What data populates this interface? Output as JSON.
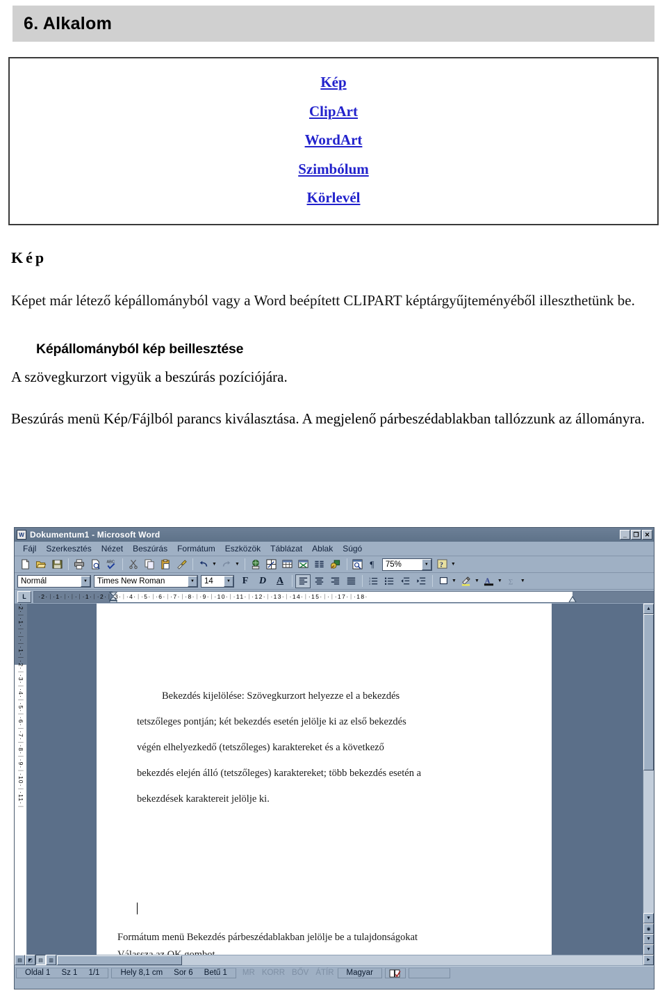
{
  "banner": {
    "title": "6. Alkalom"
  },
  "linkbox": {
    "links": [
      {
        "label": "Kép"
      },
      {
        "label": "ClipArt"
      },
      {
        "label": "WordArt"
      },
      {
        "label": "Szimbólum"
      },
      {
        "label": "Körlevél"
      }
    ]
  },
  "content": {
    "heading": "Kép",
    "intro": "Képet már létező képállományból vagy a Word beépített CLIPART képtárgyűjteményéből illeszthetünk be.",
    "subheading": "Képállományból kép beillesztése",
    "step1": "A szövegkurzort vigyük a beszúrás pozíciójára.",
    "step2": "Beszúrás menü Kép/Fájlból parancs kiválasztása. A megjelenő párbeszédablakban tallózzunk az állományra."
  },
  "word": {
    "titlebar": {
      "title": "Dokumentum1 - Microsoft Word",
      "app_icon": "W",
      "minimize": "_",
      "restore": "❐",
      "close": "✕"
    },
    "menus": [
      {
        "label": "Fájl",
        "accel": "F"
      },
      {
        "label": "Szerkesztés",
        "accel": "z"
      },
      {
        "label": "Nézet",
        "accel": "N"
      },
      {
        "label": "Beszúrás",
        "accel": "B"
      },
      {
        "label": "Formátum",
        "accel": "t"
      },
      {
        "label": "Eszközök",
        "accel": "E"
      },
      {
        "label": "Táblázat",
        "accel": "l"
      },
      {
        "label": "Ablak",
        "accel": "A"
      },
      {
        "label": "Súgó",
        "accel": "S"
      }
    ],
    "standard_toolbar": {
      "buttons": [
        "new-document-icon",
        "open-folder-icon",
        "save-disk-icon",
        "print-icon",
        "print-preview-icon",
        "spelling-check-icon",
        "cut-scissors-icon",
        "copy-icon",
        "paste-clipboard-icon",
        "format-painter-icon",
        "undo-icon",
        "undo-dropdown-icon",
        "redo-icon",
        "redo-dropdown-icon",
        "insert-hyperlink-icon",
        "tables-and-borders-icon",
        "insert-table-icon",
        "insert-excel-worksheet-icon",
        "columns-icon",
        "drawing-icon",
        "document-map-icon",
        "show-formatting-marks-icon"
      ],
      "zoom_value": "75%",
      "help_icon": "office-assistant-icon",
      "more_buttons": "more-buttons-icon"
    },
    "formatting_toolbar": {
      "style_value": "Normál",
      "font_value": "Times New Roman",
      "size_value": "14",
      "bold_label": "F",
      "italic_label": "D",
      "underline_label": "A",
      "align_buttons": [
        "align-left-icon",
        "align-center-icon",
        "align-right-icon",
        "align-justify-icon"
      ],
      "list_buttons": [
        "numbered-list-icon",
        "bulleted-list-icon",
        "decrease-indent-icon",
        "increase-indent-icon"
      ],
      "borders_icon": "borders-icon",
      "highlight_icon": "highlight-color-icon",
      "font_color_icon": "font-color-icon",
      "more_icon": "sigma-more-icon"
    },
    "ruler": {
      "tab_selector": "L",
      "horizontal_ticks": "·2·ᛁ·1·ᛁ·ᛁ·ᛁ·1·ᛁ·2·ᛁ·3·ᛁ·4·ᛁ·5·ᛁ·6·ᛁ·7·ᛁ·8·ᛁ·9·ᛁ·10·ᛁ·11·ᛁ·12·ᛁ·13·ᛁ·14·ᛁ·15·ᛁ·ᛁ·17·ᛁ·18·",
      "vertical_ticks": "·2·ᛁ·1·ᛁ·ᛁ·ᛁ·1·ᛁ·2·ᛁ·3·ᛁ·4·ᛁ·5·ᛁ·6·ᛁ·7·ᛁ·8·ᛁ·9·ᛁ·10·ᛁ·11·ᛁ"
    },
    "document": {
      "lines": [
        "Bekezdés kijelölése: Szövegkurzort helyezze el a bekezdés",
        "tetszőleges pontján; két bekezdés esetén jelölje ki az első bekezdés",
        "végén elhelyezkedő (tetszőleges) karaktereket és a következő",
        "bekezdés elején álló (tetszőleges) karaktereket; több bekezdés esetén a",
        "bekezdések karaktereit jelölje ki."
      ],
      "lines2": [
        "Formátum menü Bekezdés párbeszédablakban jelölje be a tulajdonságokat",
        "Válassza az OK gombot."
      ]
    },
    "view_buttons": [
      "normal-view-icon",
      "web-layout-view-icon",
      "print-layout-view-icon",
      "outline-view-icon"
    ],
    "statusbar": {
      "page": "Oldal 1",
      "section": "Sz 1",
      "pages": "1/1",
      "position": "Hely 8,1 cm",
      "line": "Sor 6",
      "column": "Betű 1",
      "flags": [
        "MR",
        "KORR",
        "BŐV",
        "ÁTÍR"
      ],
      "language": "Magyar",
      "spellcheck_icon": "spelling-book-icon"
    }
  },
  "colors": {
    "banner_bg": "#d0d0d0",
    "link": "#2222cc",
    "chrome": "#9fb0c4",
    "titlebar": "#5e7289",
    "canvas": "#5b6f89"
  }
}
